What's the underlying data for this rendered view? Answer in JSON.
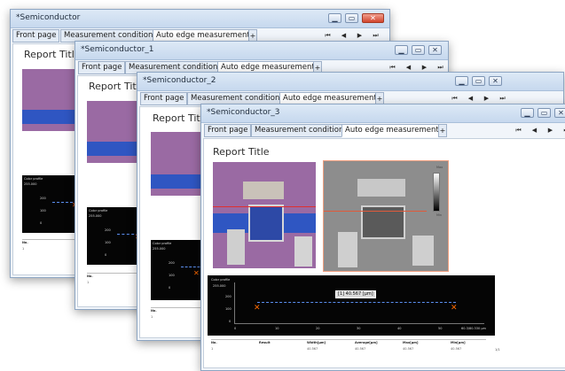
{
  "windows": [
    {
      "title": "*Semiconductor",
      "tabs": [
        "Front page",
        "Measurement condition",
        "Auto edge measurement"
      ],
      "plus": "+",
      "report_title": "Report Title"
    },
    {
      "title": "*Semiconductor_1",
      "tabs": [
        "Front page",
        "Measurement condition",
        "Auto edge measurement"
      ],
      "plus": "+",
      "report_title": "Report Title"
    },
    {
      "title": "*Semiconductor_2",
      "tabs": [
        "Front page",
        "Measurement condition",
        "Auto edge measurement"
      ],
      "plus": "+",
      "report_title": "Report Title"
    },
    {
      "title": "*Semiconductor_3",
      "tabs": [
        "Front page",
        "Measurement condition",
        "Auto edge measurement"
      ],
      "plus": "+",
      "report_title": "Report Title"
    }
  ],
  "nav_icons": [
    "first-page-icon",
    "previous-page-icon",
    "next-page-icon",
    "last-page-icon"
  ],
  "nav_glyphs": [
    "⏮",
    "◀",
    "▶",
    "⏭"
  ],
  "window_controls": {
    "minimize": "▁",
    "maximize": "▭",
    "close": "✕"
  },
  "colors": {
    "titlebar": "#c6d8ee",
    "close_button": "#d2452d",
    "chart_bg": "#050505",
    "marker": "#ff6a00",
    "measure_line": "#5c8ff0",
    "image_purple": "#9a6aa3",
    "image_blue": "#2f56c2"
  },
  "front_report": {
    "chart": {
      "label": "Color profile",
      "y_top": "255.000",
      "y_ticks": [
        "200",
        "100",
        "0"
      ],
      "x_ticks": [
        "0",
        "10",
        "20",
        "30",
        "40",
        "50",
        "60"
      ],
      "x_end": "60.3/80.330 μm",
      "measurement": "[1] 40.567 [μm]"
    },
    "table": {
      "headers": [
        "No.",
        "Result",
        "Width[μm]",
        "Average[μm]",
        "Max[μm]",
        "Min[μm]"
      ],
      "row": [
        "1",
        "",
        "40.567",
        "40.567",
        "40.567",
        "40.567"
      ],
      "page": "1/1"
    },
    "scale": {
      "top": "Max",
      "bottom": "Min"
    }
  },
  "back_reports": {
    "chart_label": "Color profile",
    "y_top": "255.000",
    "y_ticks": [
      "200",
      "100",
      "0"
    ],
    "table_header": "No.",
    "table_row": "1"
  }
}
